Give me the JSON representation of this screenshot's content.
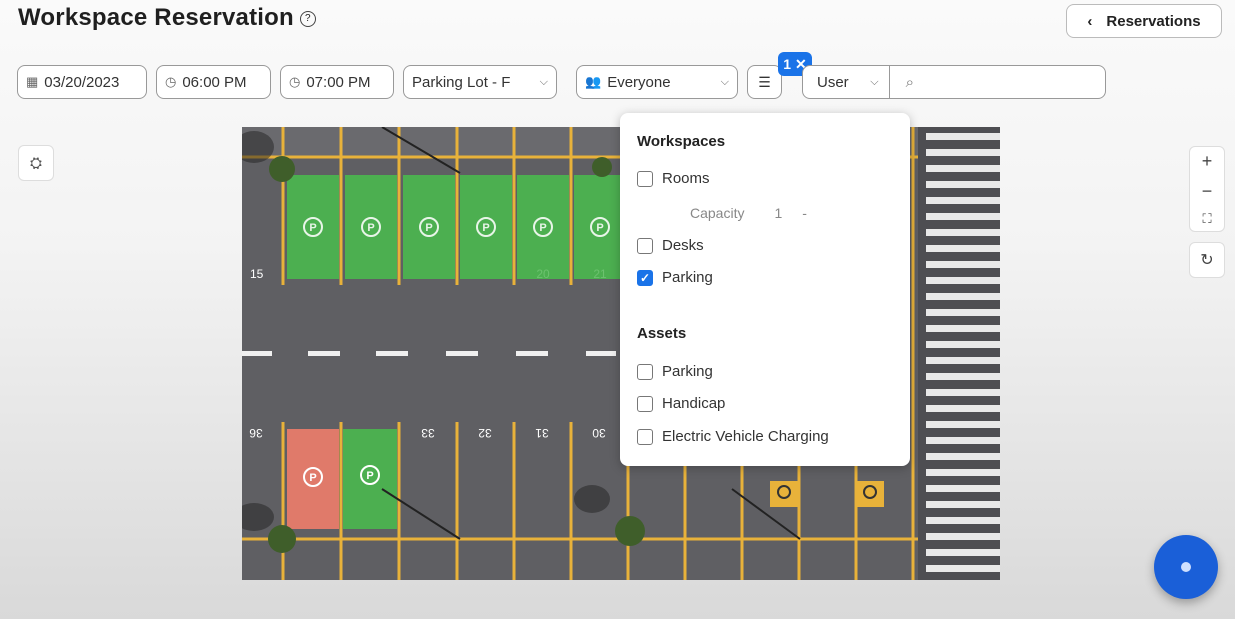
{
  "header": {
    "title": "Workspace Reservation",
    "help_icon": "help-circle-icon",
    "back_label": "Reservations"
  },
  "filters": {
    "date": "03/20/2023",
    "start_time": "06:00 PM",
    "end_time": "07:00 PM",
    "location": "Parking Lot - F",
    "audience": "Everyone",
    "filter_count": "1 ✕",
    "search_scope": "User",
    "search_placeholder": ""
  },
  "panel": {
    "workspaces_title": "Workspaces",
    "rooms": "Rooms",
    "capacity_label": "Capacity",
    "capacity_value": "1",
    "capacity_dash": "-",
    "desks": "Desks",
    "parking": "Parking",
    "assets_title": "Assets",
    "asset_parking": "Parking",
    "handicap": "Handicap",
    "ev": "Electric Vehicle Charging"
  },
  "map": {
    "top_row_label": "15",
    "top_row_ghost_labels": [
      "20",
      "21"
    ],
    "bottom_row_labels": [
      "36",
      "33",
      "32",
      "31",
      "30"
    ],
    "slot_symbol": "Ⓟ",
    "colors": {
      "available": "#4caf50",
      "reserved": "#e07a6a",
      "asphalt": "#5f5f63",
      "line": "#e8b23a"
    }
  },
  "colors": {
    "accent": "#1a73e8"
  }
}
